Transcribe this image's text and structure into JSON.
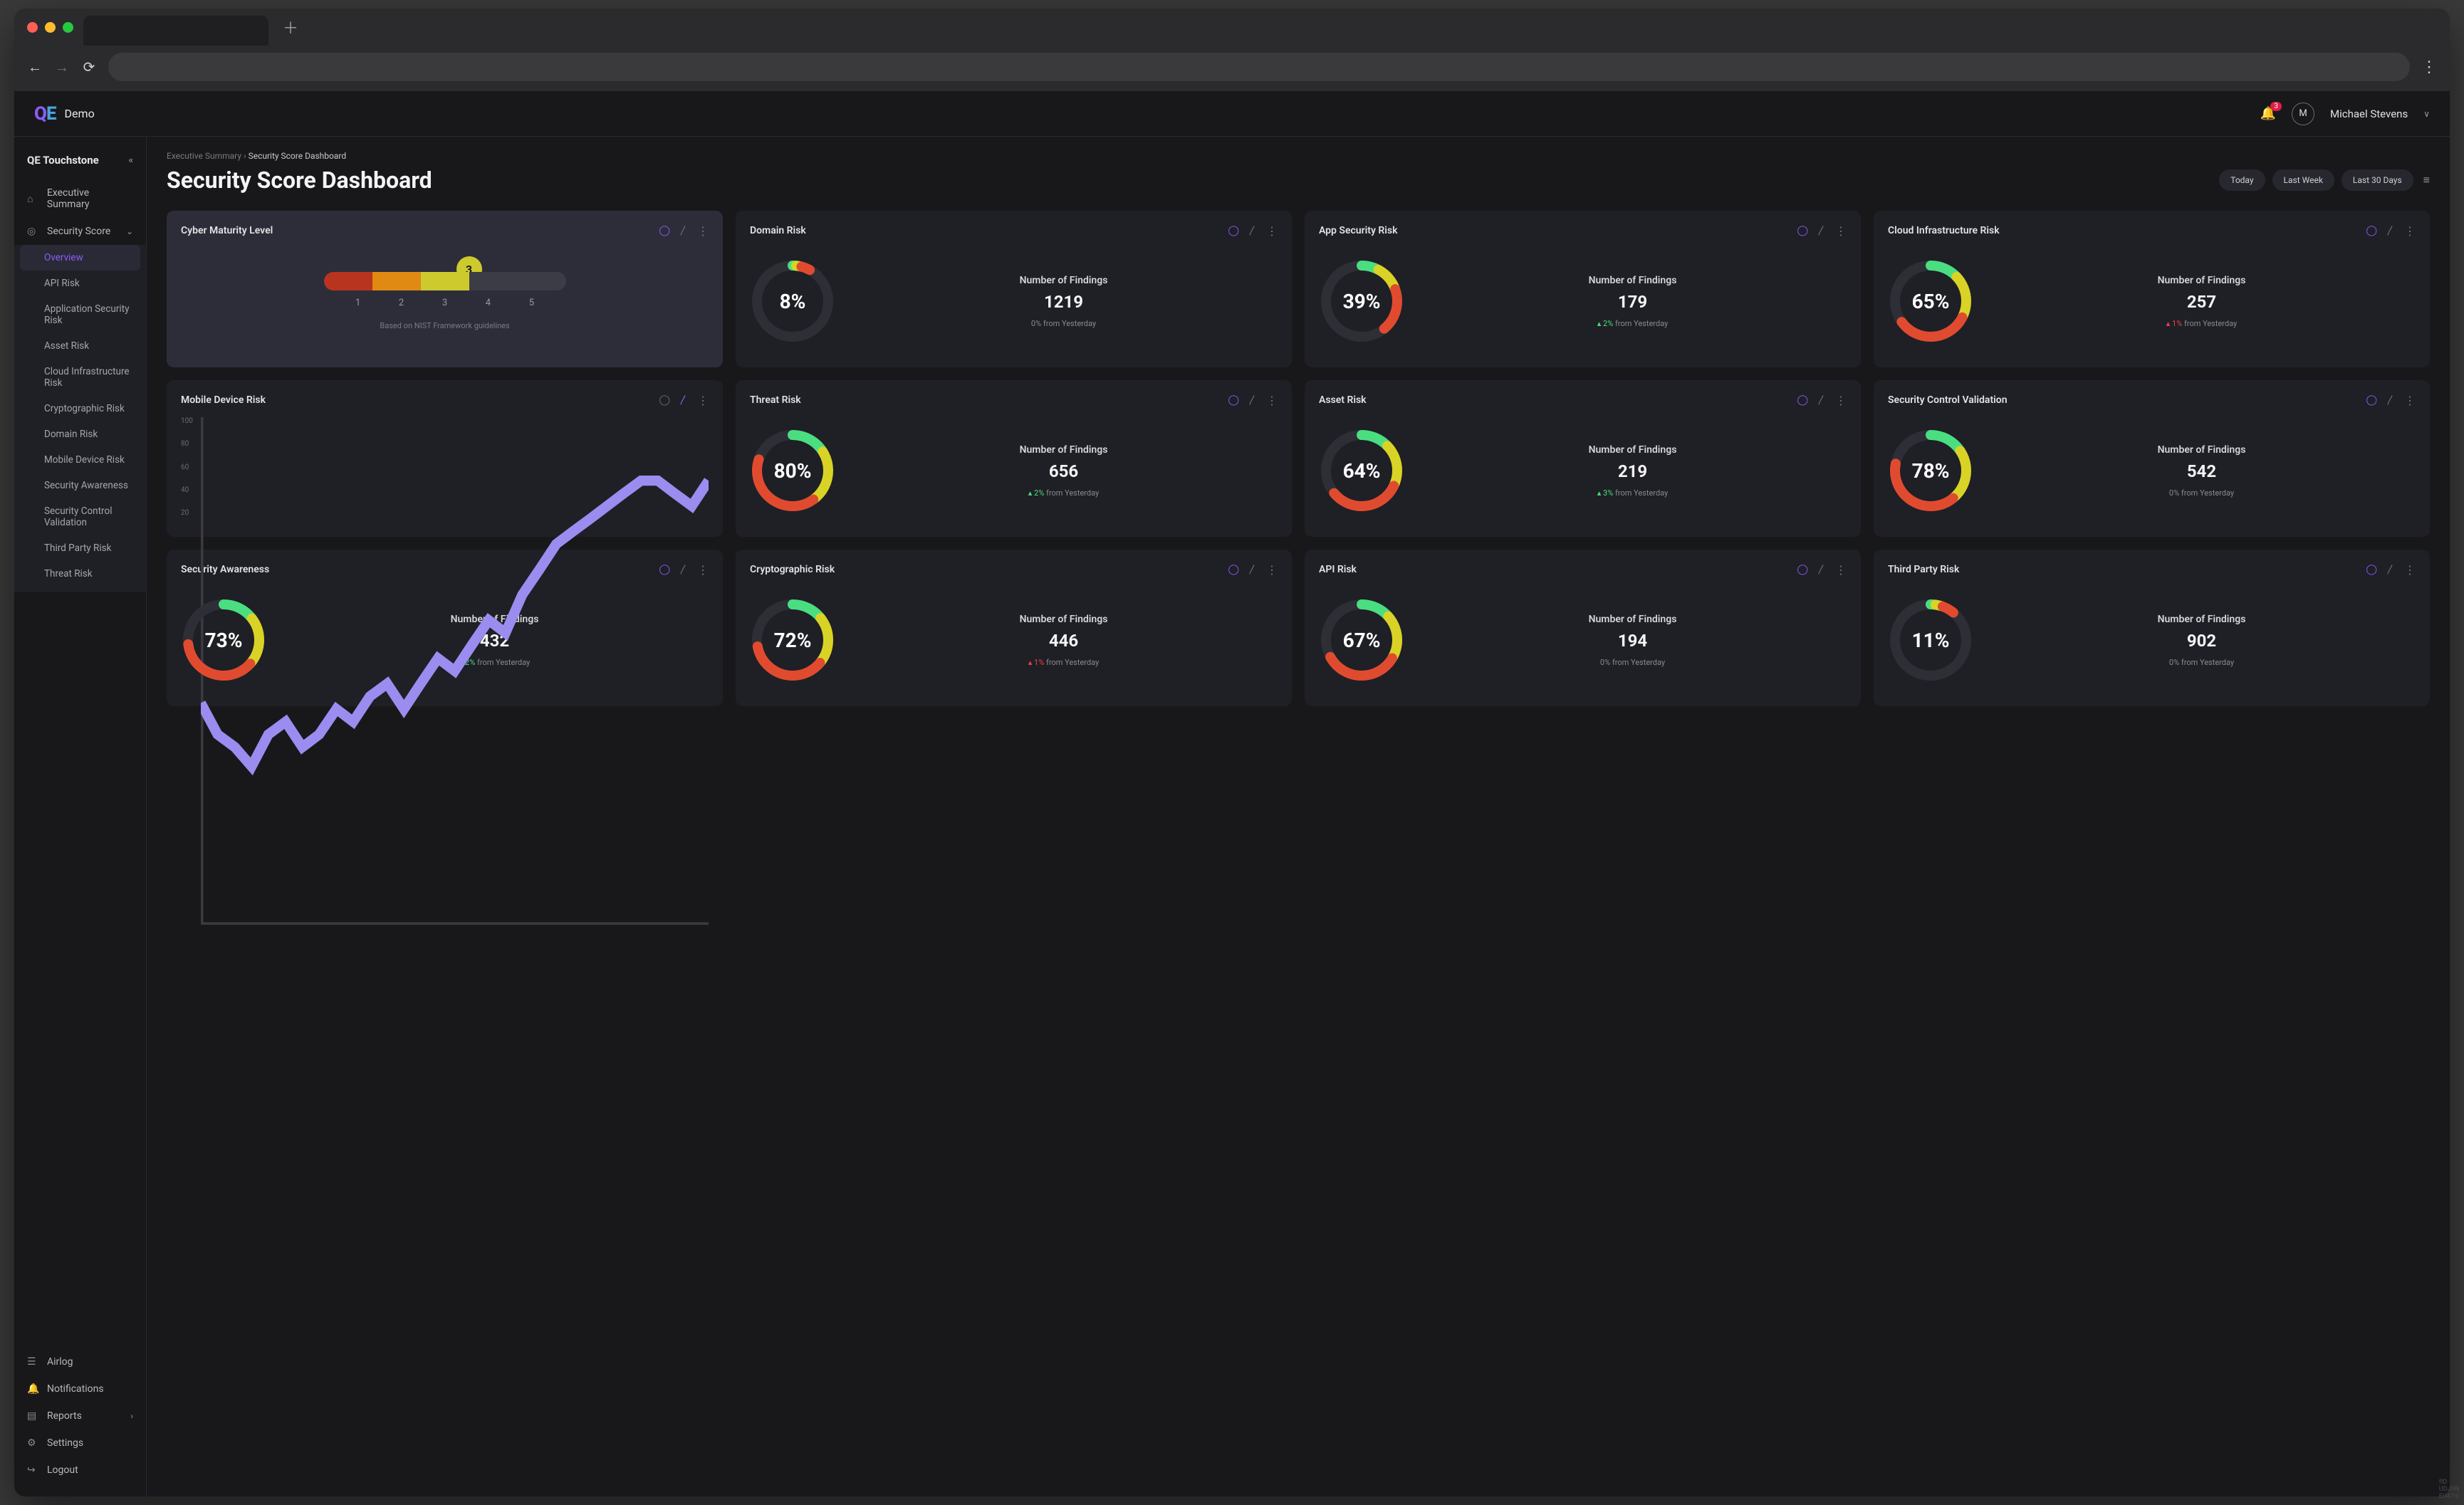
{
  "brand": {
    "prefix": "Q",
    "suffix": "E",
    "name": "Demo"
  },
  "user": {
    "initial": "M",
    "name": "Michael Stevens",
    "notifications": "3"
  },
  "sidebar": {
    "title": "QE Touchstone",
    "top": [
      {
        "icon": "home-icon",
        "label": "Executive Summary"
      },
      {
        "icon": "target-icon",
        "label": "Security Score",
        "expandable": true
      }
    ],
    "subs": [
      "Overview",
      "API Risk",
      "Application Security Risk",
      "Asset Risk",
      "Cloud Infrastructure Risk",
      "Cryptographic Risk",
      "Domain Risk",
      "Mobile Device Risk",
      "Security Awareness",
      "Security Control Validation",
      "Third Party Risk",
      "Threat Risk"
    ],
    "bottom": [
      {
        "icon": "list-icon",
        "label": "Airlog"
      },
      {
        "icon": "bell-icon",
        "label": "Notifications"
      },
      {
        "icon": "file-icon",
        "label": "Reports",
        "expandable": true
      },
      {
        "icon": "gear-icon",
        "label": "Settings"
      },
      {
        "icon": "logout-icon",
        "label": "Logout"
      }
    ]
  },
  "breadcrumb": {
    "parent": "Executive Summary",
    "current": "Security Score Dashboard"
  },
  "page_title": "Security Score Dashboard",
  "filters": [
    "Today",
    "Last Week",
    "Last 30 Days"
  ],
  "maturity": {
    "title": "Cyber Maturity Level",
    "value": "3",
    "scale": [
      "1",
      "2",
      "3",
      "4",
      "5"
    ],
    "note": "Based on NIST Framework guidelines"
  },
  "findings_label": "Number of Findings",
  "delta_suffix": " from Yesterday",
  "cards": [
    {
      "title": "Domain Risk",
      "pct": 8,
      "findings": "1219",
      "delta_dir": "",
      "delta_val": "0%"
    },
    {
      "title": "App Security Risk",
      "pct": 39,
      "findings": "179",
      "delta_dir": "up",
      "delta_val": "2%"
    },
    {
      "title": "Cloud Infrastructure Risk",
      "pct": 65,
      "findings": "257",
      "delta_dir": "down",
      "delta_val": "1%"
    },
    {
      "title": "Threat Risk",
      "pct": 80,
      "findings": "656",
      "delta_dir": "up",
      "delta_val": "2%"
    },
    {
      "title": "Asset Risk",
      "pct": 64,
      "findings": "219",
      "delta_dir": "up",
      "delta_val": "3%"
    },
    {
      "title": "Security Control Validation",
      "pct": 78,
      "findings": "542",
      "delta_dir": "",
      "delta_val": "0%"
    },
    {
      "title": "Security Awareness",
      "pct": 73,
      "findings": "432",
      "delta_dir": "up",
      "delta_val": "2%"
    },
    {
      "title": "Cryptographic Risk",
      "pct": 72,
      "findings": "446",
      "delta_dir": "down",
      "delta_val": "1%"
    },
    {
      "title": "API Risk",
      "pct": 67,
      "findings": "194",
      "delta_dir": "",
      "delta_val": "0%"
    },
    {
      "title": "Third Party Risk",
      "pct": 11,
      "findings": "902",
      "delta_dir": "",
      "delta_val": "0%"
    }
  ],
  "mobile": {
    "title": "Mobile Device Risk",
    "y_ticks": [
      "100",
      "80",
      "60",
      "40",
      "20"
    ]
  },
  "chart_data": {
    "type": "line",
    "title": "Mobile Device Risk",
    "ylim": [
      20,
      100
    ],
    "y_ticks": [
      100,
      80,
      60,
      40,
      20
    ],
    "series": [
      {
        "name": "score",
        "values": [
          55,
          50,
          48,
          45,
          50,
          52,
          48,
          50,
          54,
          52,
          56,
          58,
          54,
          58,
          62,
          60,
          64,
          68,
          66,
          72,
          76,
          80,
          82,
          84,
          86,
          88,
          90,
          90,
          88,
          86,
          90
        ]
      }
    ]
  }
}
